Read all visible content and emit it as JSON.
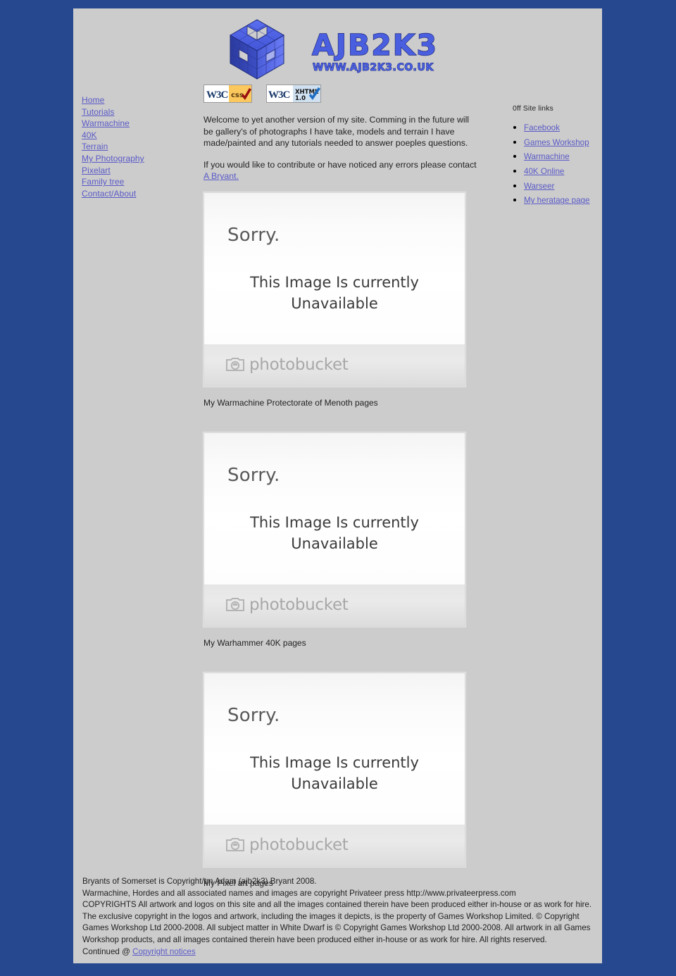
{
  "site": {
    "logo_title": "AJB2K3",
    "logo_subtitle": "WWW.AJB2K3.CO.UK"
  },
  "badges": [
    {
      "name": "w3c-css-badge",
      "mark": "W3C",
      "label": "CSS"
    },
    {
      "name": "w3c-xhtml-badge",
      "mark": "W3C",
      "label": "XHTML",
      "label2": "1.0"
    }
  ],
  "sidebar": {
    "items": [
      {
        "label": "Home"
      },
      {
        "label": "Tutorials"
      },
      {
        "label": "Warmachine"
      },
      {
        "label": "40K"
      },
      {
        "label": "Terrain"
      },
      {
        "label": "My Photography"
      },
      {
        "label": "Pixelart"
      },
      {
        "label": "Family tree"
      },
      {
        "label": "Contact/About"
      }
    ]
  },
  "main": {
    "intro_paragraph": "Welcome to yet another version of my site. Comming in the future will be gallery's of photographs I have take, models and terrain I have made/painted and any tutorials needed to answer poeples questions.",
    "contact_text": "If you would like to contribute or have noticed any errors please contact ",
    "contact_link": "A Bryant.",
    "figures": [
      {
        "placeholder_sorry": "Sorry.",
        "placeholder_message": "This Image Is currently Unavailable",
        "placeholder_brand": "photobucket",
        "caption": "My Warmachine Protectorate of Menoth pages"
      },
      {
        "placeholder_sorry": "Sorry.",
        "placeholder_message": "This Image Is currently Unavailable",
        "placeholder_brand": "photobucket",
        "caption": "My Warhammer 40K pages"
      },
      {
        "placeholder_sorry": "Sorry.",
        "placeholder_message": "This Image Is currently Unavailable",
        "placeholder_brand": "photobucket",
        "caption": "My Pixel art pages"
      }
    ]
  },
  "offsite": {
    "heading": "0ff Site links",
    "links": [
      {
        "label": "Facebook"
      },
      {
        "label": "Games Workshop"
      },
      {
        "label": "Warmachine"
      },
      {
        "label": "40K Online"
      },
      {
        "label": "Warseer"
      },
      {
        "label": "My heratage page"
      }
    ]
  },
  "footer": {
    "line1": "Bryants of Somerset is Copyright/tm Adam (ajb2k3) Bryant 2008.",
    "line2": "Warmachine, Hordes and all associated names and images are copyright Privateer press http://www.privateerpress.com",
    "line3": "COPYRIGHTS All artwork and logos on this site and all the images contained therein have been produced either in-house or as work for hire. The exclusive copyright in the logos and artwork, including the images it depicts, is the property of Games Workshop Limited. © Copyright Games Workshop Ltd 2000-2008. All subject matter in White Dwarf is © Copyright Games Workshop Ltd 2000-2008. All artwork in all Games Workshop products, and all images contained therein have been produced either in-house or as work for hire. All rights reserved.",
    "continued_prefix": "Continued @ ",
    "continued_link": "Copyright notices"
  },
  "colors": {
    "page_background": "#26488f",
    "content_background": "#cccccc",
    "link": "#5a5ac8",
    "logo_blue": "#3b4fc4"
  }
}
